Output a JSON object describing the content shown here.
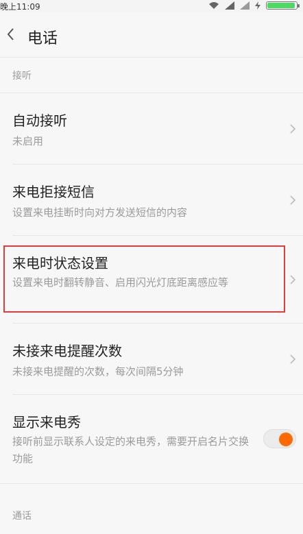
{
  "status_bar": {
    "time": "晚上11:09"
  },
  "header": {
    "title": "电话"
  },
  "sections": [
    {
      "header": "接听",
      "items": [
        {
          "title": "自动接听",
          "subtitle": "未启用"
        },
        {
          "title": "来电拒接短信",
          "subtitle": "设置来电挂断时向对方发送短信的内容"
        },
        {
          "title": "来电时状态设置",
          "subtitle": "设置来电时翻转静音、启用闪光灯底距离感应等"
        },
        {
          "title": "未接来电提醒次数",
          "subtitle": "未接来电提醒的次数，每次间隔5分钟"
        },
        {
          "title": "显示来电秀",
          "subtitle": "接听前显示联系人设定的来电秀，需要开启名片交换功能",
          "toggle_on": true
        }
      ]
    },
    {
      "header": "通话"
    }
  ],
  "colors": {
    "accent": "#ff6a00",
    "highlight": "#e33a3a"
  }
}
